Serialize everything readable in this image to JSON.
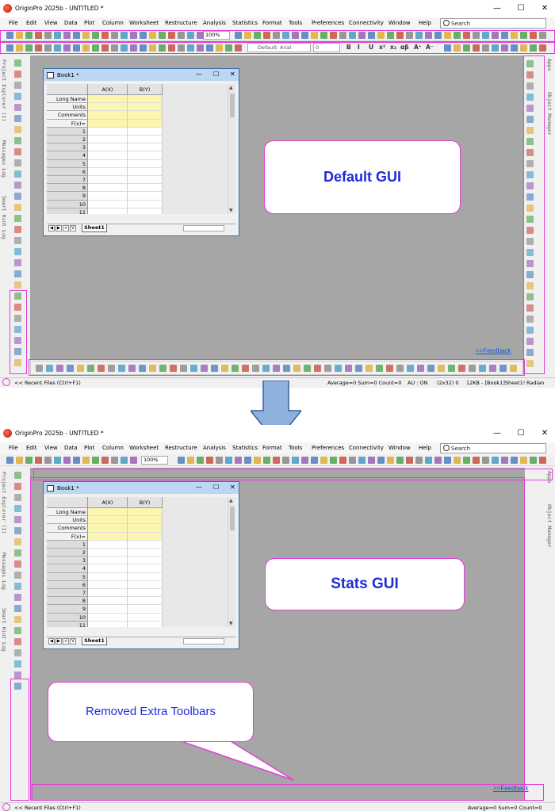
{
  "window": {
    "title": "OriginPro 2025b - UNTITLED *",
    "minimize_glyph": "—",
    "maximize_glyph": "☐",
    "close_glyph": "✕"
  },
  "menu": {
    "items": [
      "File",
      "Edit",
      "View",
      "Data",
      "Plot",
      "Column",
      "Worksheet",
      "Restructure",
      "Analysis",
      "Statistics",
      "Format",
      "Tools",
      "Preferences",
      "Connectivity",
      "Window",
      "Help"
    ],
    "search_label": "Search"
  },
  "toolbar": {
    "zoom_value": "100%",
    "font_value": "Default: Arial",
    "font_size_value": "0",
    "format_buttons": [
      "B",
      "I",
      "U",
      "x²",
      "x₂",
      "αβ",
      "A⁺",
      "A⁻"
    ]
  },
  "left_panel_tabs": [
    "Project Explorer (1)",
    "Messages Log",
    "Smart Hint Log"
  ],
  "right_panel_tabs": [
    "Apps",
    "Object Manager"
  ],
  "book": {
    "title": "Book1 *",
    "columns": [
      "A(X)",
      "B(Y)"
    ],
    "meta_rows": [
      "Long Name",
      "Units",
      "Comments",
      "F(x)="
    ],
    "row_numbers": [
      "1",
      "2",
      "3",
      "4",
      "5",
      "6",
      "7",
      "8",
      "9",
      "10",
      "11"
    ],
    "sheet_tab": "Sheet1",
    "nav_buttons": [
      "◀",
      "▶",
      "+",
      "V"
    ],
    "minimize_glyph": "—",
    "maximize_glyph": "☐",
    "close_glyph": "✕"
  },
  "callouts": {
    "default_gui": "Default GUI",
    "stats_gui": "Stats GUI",
    "removed": "Removed Extra Toolbars"
  },
  "feedback_link": ">>Feedback",
  "status": {
    "recent_files": "<< Recent Files (Ctrl+F1)",
    "stats_top": "Average=0 Sum=0 Count=0",
    "au": "AU : ON",
    "dims": "(2x32) 0",
    "size": "12KB - [Book1]Sheet1!",
    "unit": "Radian",
    "stats_bottom": "Average=0 Sum=0 Count=0"
  },
  "colors": {
    "highlight": "#e23ed8",
    "callout_text": "#1f2bd6",
    "workspace": "#a6a6a6",
    "meta_cells": "#fbf5b0",
    "arrow": "#8fb1dd"
  },
  "icons": {
    "app_logo": "origin-logo-icon",
    "search": "search-icon",
    "book": "worksheet-icon",
    "arrow": "down-arrow-icon"
  }
}
